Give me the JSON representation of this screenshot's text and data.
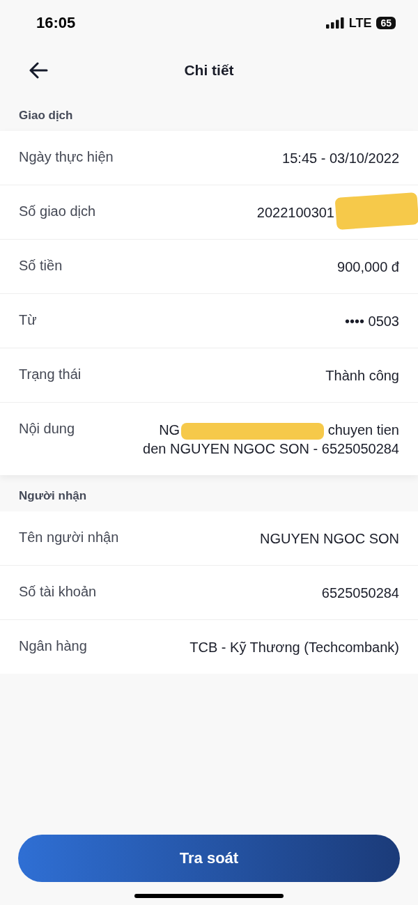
{
  "status_bar": {
    "time": "16:05",
    "network": "LTE",
    "battery": "65"
  },
  "header": {
    "title": "Chi tiết"
  },
  "sections": [
    {
      "title": "Giao dịch",
      "rows": [
        {
          "label": "Ngày thực hiện",
          "value": "15:45 - 03/10/2022",
          "redacted": false
        },
        {
          "label": "Số giao dịch",
          "value": "2022100301",
          "redacted": true
        },
        {
          "label": "Số tiền",
          "value": "900,000 đ",
          "redacted": false
        },
        {
          "label": "Từ",
          "value": "•••• 0503",
          "redacted": false
        },
        {
          "label": "Trạng thái",
          "value": "Thành công",
          "redacted": false
        },
        {
          "label": "Nội dung",
          "value_before": "NG",
          "value": "chuyen tien den NGUYEN NGOC SON - 6525050284",
          "redacted": true
        }
      ]
    },
    {
      "title": "Người nhận",
      "rows": [
        {
          "label": "Tên người nhận",
          "value": "NGUYEN NGOC SON",
          "redacted": false
        },
        {
          "label": "Số tài khoản",
          "value": "6525050284",
          "redacted": false
        },
        {
          "label": "Ngân hàng",
          "value": "TCB - Kỹ Thương (Techcombank)",
          "redacted": false
        }
      ]
    }
  ],
  "button": {
    "label": "Tra soát"
  }
}
